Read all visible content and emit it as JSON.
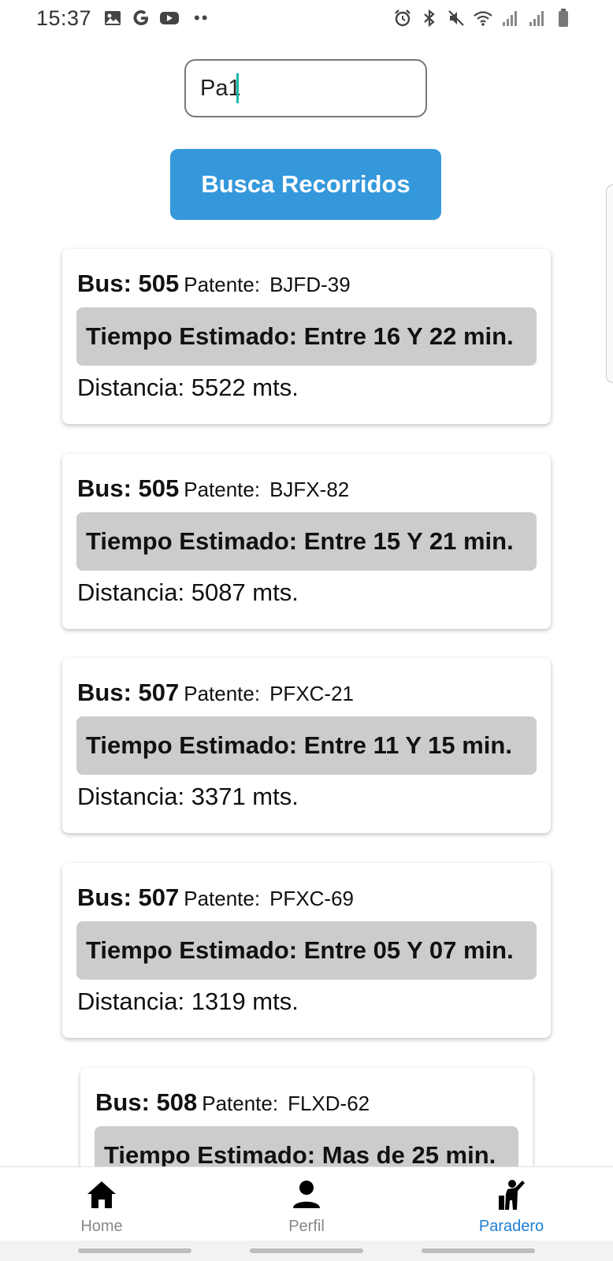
{
  "status_bar": {
    "time": "15:37"
  },
  "search": {
    "value": "Pa1"
  },
  "search_button": {
    "label": "Busca Recorridos"
  },
  "results": [
    {
      "bus_label": "Bus: 505",
      "patente_label": "Patente:",
      "plate": "BJFD-39",
      "time": "Tiempo Estimado: Entre 16 Y 22 min.",
      "distance": "Distancia: 5522 mts."
    },
    {
      "bus_label": "Bus: 505",
      "patente_label": "Patente:",
      "plate": "BJFX-82",
      "time": "Tiempo Estimado: Entre 15 Y 21 min.",
      "distance": "Distancia: 5087 mts."
    },
    {
      "bus_label": "Bus: 507",
      "patente_label": "Patente:",
      "plate": "PFXC-21",
      "time": "Tiempo Estimado: Entre 11 Y 15 min.",
      "distance": "Distancia: 3371 mts."
    },
    {
      "bus_label": "Bus: 507",
      "patente_label": "Patente:",
      "plate": "PFXC-69",
      "time": "Tiempo Estimado: Entre 05 Y 07 min.",
      "distance": "Distancia: 1319 mts."
    },
    {
      "bus_label": "Bus: 508",
      "patente_label": "Patente:",
      "plate": "FLXD-62",
      "time": "Tiempo Estimado: Mas de 25 min.",
      "distance": ""
    }
  ],
  "bottom_nav": {
    "items": [
      {
        "label": "Home",
        "icon": "home-icon"
      },
      {
        "label": "Perfil",
        "icon": "person-icon"
      },
      {
        "label": "Paradero",
        "icon": "bus-stop-person-icon",
        "active": true
      }
    ],
    "active_color": "#1e7fd6"
  },
  "colors": {
    "accent": "#3498db",
    "time_box": "#cccccc",
    "caret": "#19b8a6"
  }
}
